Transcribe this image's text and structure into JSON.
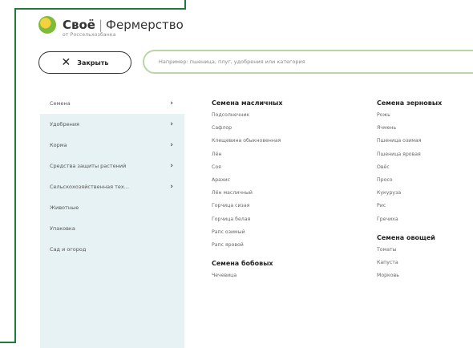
{
  "logo": {
    "brand": "Своё",
    "name": "Фермерство",
    "sub": "от Россельхозбанка"
  },
  "close_button": {
    "label": "Закрыть"
  },
  "search": {
    "placeholder": "Например: пшеница, плуг, удобрения или категория"
  },
  "sidebar": {
    "items": [
      {
        "label": "Семена",
        "chevron": true,
        "active": true
      },
      {
        "label": "Удобрения",
        "chevron": true
      },
      {
        "label": "Корма",
        "chevron": true
      },
      {
        "label": "Средства защиты растений",
        "chevron": true
      },
      {
        "label": "Сельскохозяйственная тех...",
        "chevron": true
      },
      {
        "label": "Животные",
        "chevron": false
      },
      {
        "label": "Упаковка",
        "chevron": false
      },
      {
        "label": "Сад и огород",
        "chevron": false
      }
    ]
  },
  "columns": [
    {
      "groups": [
        {
          "title": "Семена масличных",
          "items": [
            "Подсолнечник",
            "Сафлор",
            "Клещевина обыкновенная",
            "Лён",
            "Соя",
            "Арахис",
            "Лён масличный",
            "Горчица сизая",
            "Горчица белая",
            "Рапс озимый",
            "Рапс яровой"
          ]
        },
        {
          "title": "Семена бобовых",
          "items": [
            "Чечевица"
          ]
        }
      ]
    },
    {
      "groups": [
        {
          "title": "Семена зерновых",
          "items": [
            "Рожь",
            "Ячмень",
            "Пшеница озимая",
            "Пшеница яровая",
            "Овёс",
            "Просо",
            "Кукуруза",
            "Рис",
            "Гречиха"
          ]
        },
        {
          "title": "Семена овощей",
          "items": [
            "Томаты",
            "Капуста",
            "Морковь"
          ]
        }
      ]
    }
  ]
}
